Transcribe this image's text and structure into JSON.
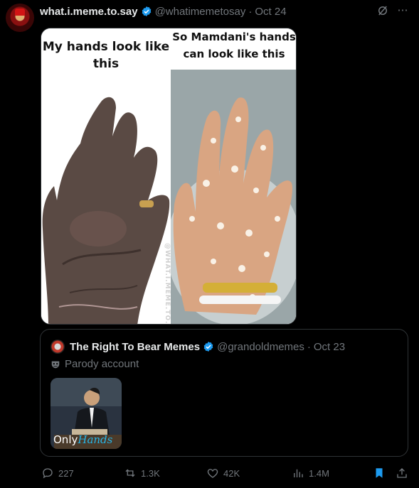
{
  "post": {
    "author_name": "what.i.meme.to.say",
    "handle": "@whatimemetosay",
    "separator": "·",
    "date": "Oct 24"
  },
  "meme": {
    "left_caption": "My hands look like this",
    "right_caption": "So Mamdani's hands can look like this",
    "watermark": "@WHAT.I.MEME.TO.SAY"
  },
  "quoted": {
    "author_name": "The Right To Bear Memes",
    "handle": "@grandoldmemes",
    "separator": "·",
    "date": "Oct 23",
    "label": "Parody account",
    "thumb_text_only": "Only",
    "thumb_text_hands": "Hands"
  },
  "actions": {
    "replies": "227",
    "reposts": "1.3K",
    "likes": "42K",
    "views": "1.4M"
  },
  "colors": {
    "background": "#000000",
    "verified": "#1d9bf0",
    "bookmark_active": "#1d9bf0",
    "muted": "#71767b"
  },
  "icons": [
    "grok-icon",
    "more-icon",
    "reply-icon",
    "repost-icon",
    "like-icon",
    "views-icon",
    "bookmark-icon",
    "share-icon",
    "verified-badge-icon",
    "parody-mask-icon"
  ]
}
